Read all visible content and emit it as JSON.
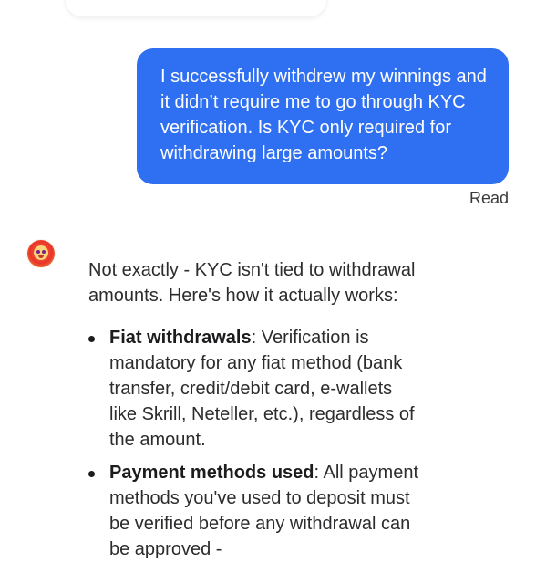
{
  "user_message": {
    "text": "I successfully withdrew my winnings and it didn’t require me to go through KYC verification. Is KYC only required for withdrawing large amounts?",
    "status": "Read",
    "bubble_color": "#2f6ff2"
  },
  "assistant_message": {
    "avatar_icon": "parrot-avatar-icon",
    "intro": "Not exactly - KYC isn't tied to withdrawal amounts. Here's how it actually works:",
    "bullets": [
      {
        "title": "Fiat withdrawals",
        "text": ": Verification is mandatory for any fiat method (bank transfer, credit/debit card, e-wallets like Skrill, Neteller, etc.), regardless of the amount."
      },
      {
        "title": "Payment methods used",
        "text": ": All payment methods you've used to deposit must be verified before any withdrawal can be approved -"
      }
    ]
  }
}
